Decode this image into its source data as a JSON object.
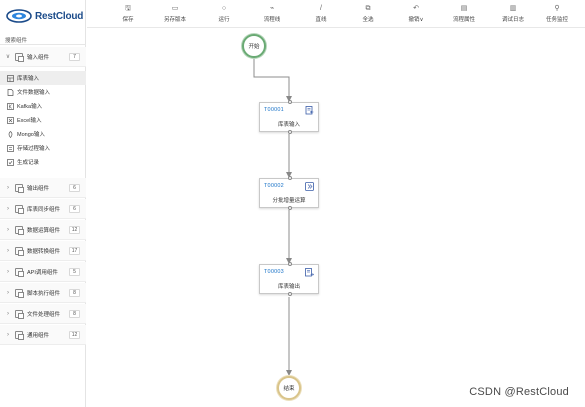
{
  "app": {
    "brand": "RestCloud"
  },
  "sidebar": {
    "search_label": "搜索组件",
    "groups": [
      {
        "label": "输入组件",
        "count": "7",
        "expanded": true
      },
      {
        "label": "输出组件",
        "count": "6"
      },
      {
        "label": "库表同步组件",
        "count": "6"
      },
      {
        "label": "数据运算组件",
        "count": "12"
      },
      {
        "label": "数据转换组件",
        "count": "17"
      },
      {
        "label": "API调用组件",
        "count": "5"
      },
      {
        "label": "脚本执行组件",
        "count": "8"
      },
      {
        "label": "文件处理组件",
        "count": "8"
      },
      {
        "label": "通用组件",
        "count": "12"
      }
    ],
    "input_items": [
      {
        "label": "库表输入",
        "icon": "table-input-icon",
        "active": true
      },
      {
        "label": "文件数据输入",
        "icon": "file-icon"
      },
      {
        "label": "Kafka输入",
        "icon": "kafka-icon"
      },
      {
        "label": "Excel输入",
        "icon": "excel-icon"
      },
      {
        "label": "Mongo输入",
        "icon": "mongo-icon"
      },
      {
        "label": "存储过程输入",
        "icon": "procedure-icon"
      },
      {
        "label": "生成记录",
        "icon": "record-icon"
      }
    ]
  },
  "toolbar": {
    "save": "保存",
    "save_as": "另存版本",
    "run": "运行",
    "flowline": "流程线",
    "straight": "直线",
    "select_all": "全选",
    "undo": "撤销",
    "flow_props": "流程属性",
    "debug_log": "调试日志",
    "task_monitor": "任务监控"
  },
  "canvas": {
    "start_label": "开始",
    "end_label": "结束",
    "nodes": [
      {
        "id": "T00001",
        "name": "库表输入"
      },
      {
        "id": "T00002",
        "name": "分批增量运算"
      },
      {
        "id": "T00003",
        "name": "库表输出"
      }
    ]
  },
  "watermark": "CSDN @RestCloud",
  "colors": {
    "brand": "#1b4b8a",
    "node_id": "#1a73c8",
    "start": "#6aaa74",
    "end": "#d9c48a"
  }
}
